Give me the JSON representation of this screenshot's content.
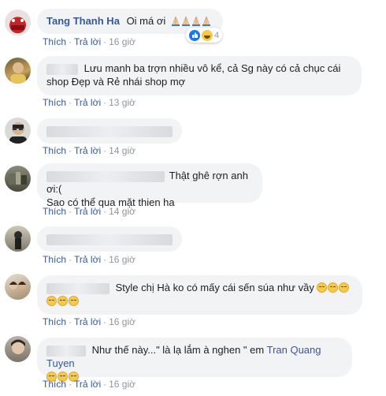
{
  "comments": [
    {
      "author": "Tang Thanh Ha",
      "text": "Oi má ơi",
      "reaction_count": "4",
      "actions": {
        "like": "Thích",
        "reply": "Trả lời",
        "time": "16 giờ"
      }
    },
    {
      "text_line1": "Lưu manh ba trợn nhiều vô kể, cả Sg này có cả chục cái",
      "text_line2": "shop Đẹp và Rẻ nhái shop mợ",
      "actions": {
        "like": "Thích",
        "reply": "Trả lời",
        "time": "13 giờ"
      }
    },
    {
      "actions": {
        "like": "Thích",
        "reply": "Trả lời",
        "time": "14 giờ"
      }
    },
    {
      "text_line1": "Thật ghê rợn anh ơi:(",
      "text_line2": "Sao có thể qua mặt thien ha",
      "actions": {
        "like": "Thích",
        "reply": "Trả lời",
        "time": "14 giờ"
      }
    },
    {
      "actions": {
        "like": "Thích",
        "reply": "Trả lời",
        "time": "16 giờ"
      }
    },
    {
      "text_line1": "Style chị Hà ko có mấy cái sến súa như vầy",
      "actions": {
        "like": "Thích",
        "reply": "Trả lời",
        "time": "16 giờ"
      }
    },
    {
      "text_pre": "Như thế này...\" là lạ lắm à nghen \" em",
      "mention": "Tran Quang Tuyen",
      "actions": {
        "like": "Thích",
        "reply": "Trả lời",
        "time": "16 giờ"
      }
    }
  ],
  "icons": {
    "pray": "folded-hands-emoji",
    "expressionless": "expressionless-face-emoji",
    "pensive": "pensive-face-emoji",
    "like": "like-reaction",
    "haha": "haha-reaction"
  },
  "colors": {
    "link": "#385898",
    "meta": "#90949c",
    "bubble": "#f2f3f5",
    "like_blue": "#1877f2"
  }
}
